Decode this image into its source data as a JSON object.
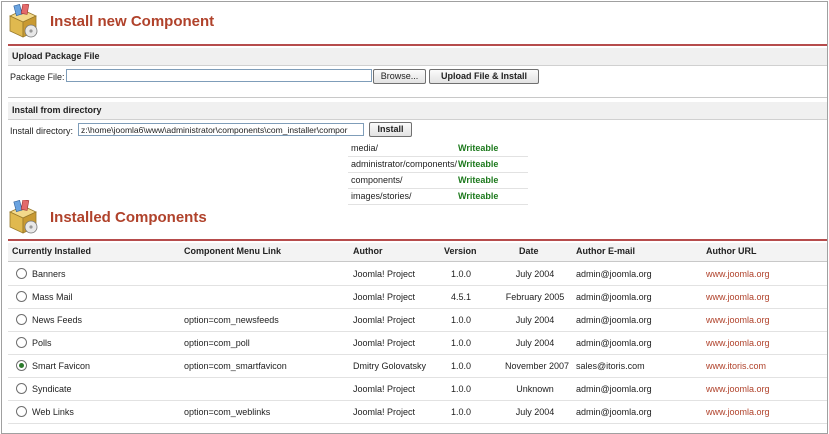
{
  "install_section": {
    "title": "Install new Component",
    "upload": {
      "header": "Upload Package File",
      "label": "Package File:",
      "file_value": "",
      "browse_label": "Browse...",
      "upload_button": "Upload File & Install"
    },
    "directory": {
      "header": "Install from directory",
      "label": "Install directory:",
      "value": "z:\\home\\joomla6\\www\\administrator\\components\\com_installer\\compor",
      "install_button": "Install"
    },
    "dirs": [
      {
        "path": "media/",
        "status": "Writeable"
      },
      {
        "path": "administrator/components/",
        "status": "Writeable"
      },
      {
        "path": "components/",
        "status": "Writeable"
      },
      {
        "path": "images/stories/",
        "status": "Writeable"
      }
    ]
  },
  "installed_section": {
    "title": "Installed Components",
    "columns": [
      "Currently Installed",
      "Component Menu Link",
      "Author",
      "Version",
      "Date",
      "Author E-mail",
      "Author URL"
    ],
    "rows": [
      {
        "name": "Banners",
        "link": "",
        "author": "Joomla! Project",
        "version": "1.0.0",
        "date": "July 2004",
        "email": "admin@joomla.org",
        "url": "www.joomla.org",
        "selected": false
      },
      {
        "name": "Mass Mail",
        "link": "",
        "author": "Joomla! Project",
        "version": "4.5.1",
        "date": "February 2005",
        "email": "admin@joomla.org",
        "url": "www.joomla.org",
        "selected": false
      },
      {
        "name": "News Feeds",
        "link": "option=com_newsfeeds",
        "author": "Joomla! Project",
        "version": "1.0.0",
        "date": "July 2004",
        "email": "admin@joomla.org",
        "url": "www.joomla.org",
        "selected": false
      },
      {
        "name": "Polls",
        "link": "option=com_poll",
        "author": "Joomla! Project",
        "version": "1.0.0",
        "date": "July 2004",
        "email": "admin@joomla.org",
        "url": "www.joomla.org",
        "selected": false
      },
      {
        "name": "Smart Favicon",
        "link": "option=com_smartfavicon",
        "author": "Dmitry Golovatsky",
        "version": "1.0.0",
        "date": "November 2007",
        "email": "sales@itoris.com",
        "url": "www.itoris.com",
        "selected": true
      },
      {
        "name": "Syndicate",
        "link": "",
        "author": "Joomla! Project",
        "version": "1.0.0",
        "date": "Unknown",
        "email": "admin@joomla.org",
        "url": "www.joomla.org",
        "selected": false
      },
      {
        "name": "Web Links",
        "link": "option=com_weblinks",
        "author": "Joomla! Project",
        "version": "1.0.0",
        "date": "July 2004",
        "email": "admin@joomla.org",
        "url": "www.joomla.org",
        "selected": false
      }
    ]
  },
  "colors": {
    "accent": "#b0422b",
    "writeable": "#1e7a1e",
    "rule": "#b64c4c"
  },
  "icons": [
    "install-box-icon",
    "install-box-icon"
  ]
}
